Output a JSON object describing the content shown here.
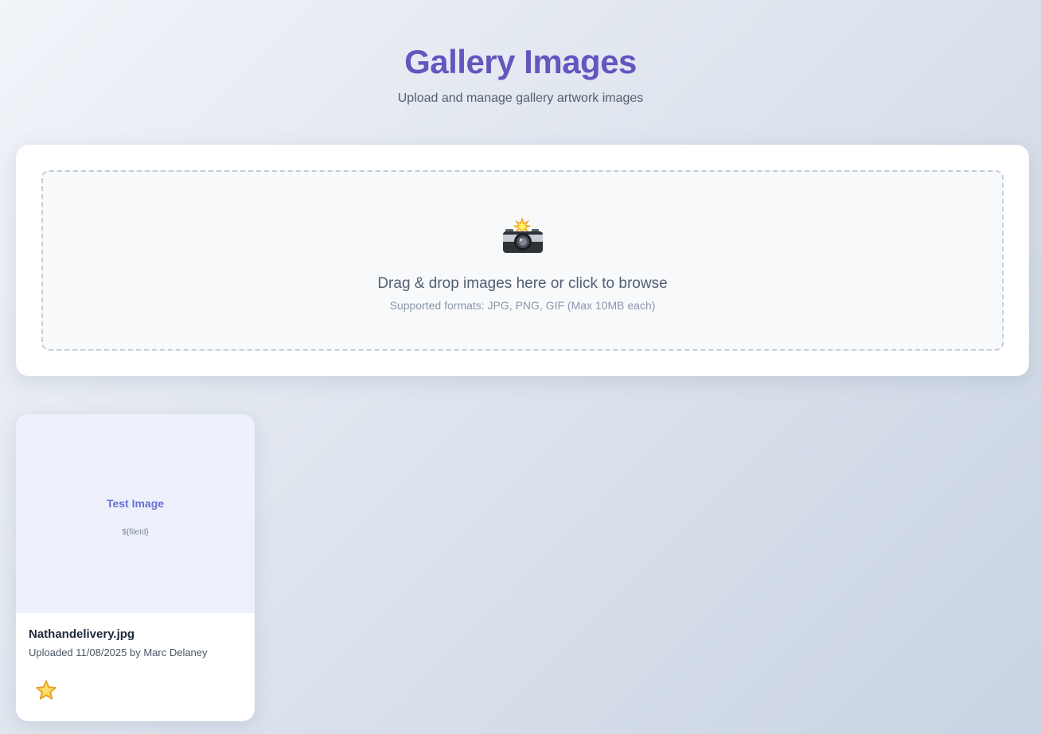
{
  "header": {
    "title": "Gallery Images",
    "subtitle": "Upload and manage gallery artwork images"
  },
  "upload": {
    "icon": "camera-flash-icon",
    "prompt": "Drag & drop images here or click to browse",
    "formats": "Supported formats: JPG, PNG, GIF (Max 10MB each)"
  },
  "gallery": {
    "images": [
      {
        "preview_title": "Test Image",
        "preview_id": "${fileId}",
        "file_name": "Nathandelivery.jpg",
        "meta": "Uploaded 11/08/2025 by Marc Delaney",
        "favorite_icon": "star-icon"
      }
    ]
  },
  "colors": {
    "accent": "#6356bf",
    "preview_bg": "#eef1fc",
    "preview_text": "#6571d4",
    "star": "#f5b82e"
  }
}
